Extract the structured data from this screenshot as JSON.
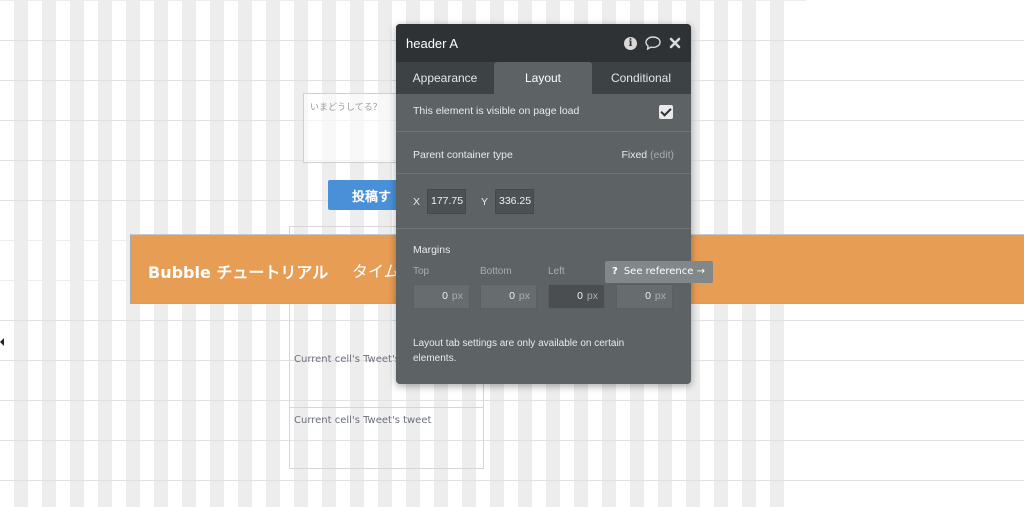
{
  "canvas": {
    "textbox_placeholder": "いまどうしてる？",
    "post_button_label": "投稿す",
    "cell_text_1": "Current cell's Tweet's t",
    "cell_text_2": "Current cell's Tweet's tweet"
  },
  "header_element": {
    "title": "Bubble チュートリアル",
    "link": "タイム",
    "color": "#e89d55"
  },
  "inspector": {
    "title": "header A",
    "icons": [
      "info-icon",
      "comment-icon",
      "close-icon"
    ],
    "tabs": [
      {
        "label": "Appearance",
        "active": false
      },
      {
        "label": "Layout",
        "active": true
      },
      {
        "label": "Conditional",
        "active": false
      }
    ],
    "visible_on_load_label": "This element is visible on page load",
    "visible_on_load": true,
    "parent_container_label": "Parent container type",
    "parent_container_value": "Fixed",
    "parent_container_edit": "(edit)",
    "x_label": "X",
    "x_value": "177.75",
    "y_label": "Y",
    "y_value": "336.25",
    "margins_label": "Margins",
    "margins": {
      "top_label": "Top",
      "top_value": "0",
      "bottom_label": "Bottom",
      "bottom_value": "0",
      "left_label": "Left",
      "left_value": "0",
      "right_value": "0",
      "unit": "px"
    },
    "see_reference": "See reference →",
    "note": "Layout tab settings are only available on certain elements."
  }
}
